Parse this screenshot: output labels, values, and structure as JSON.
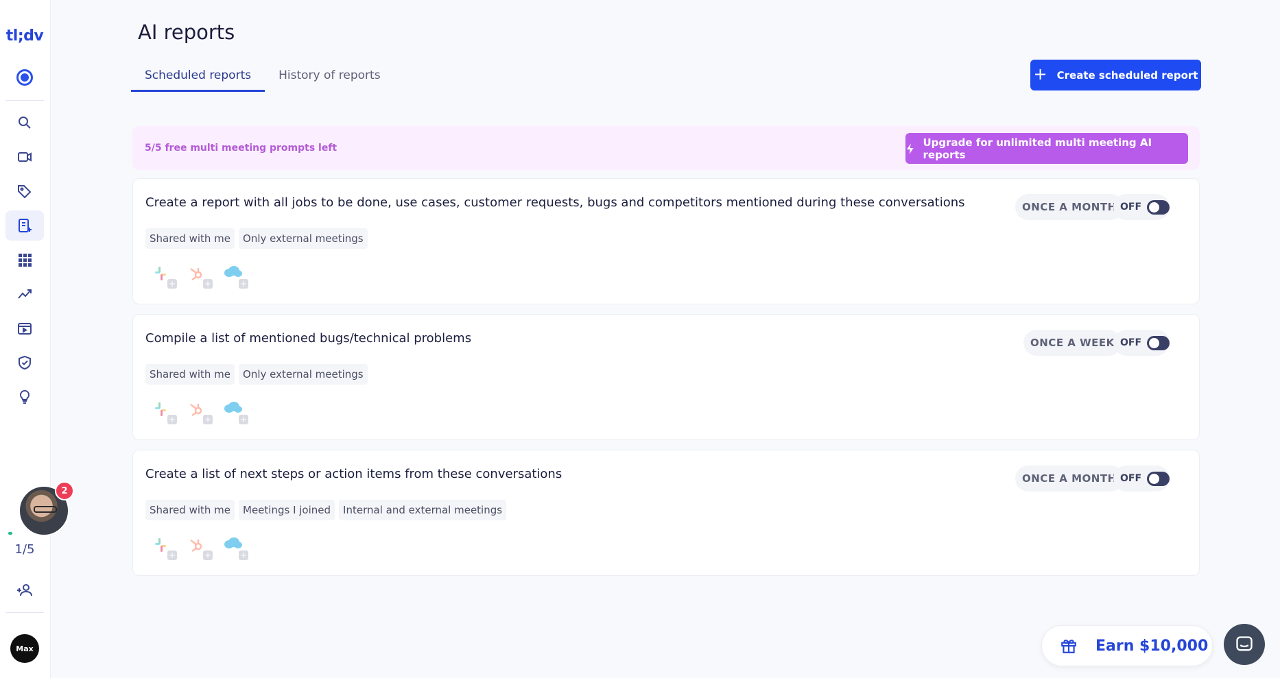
{
  "app": {
    "logo": "tl;dv"
  },
  "sidebar": {
    "items": [
      {
        "icon": "record-icon"
      },
      {
        "icon": "search-icon"
      },
      {
        "icon": "video-icon"
      },
      {
        "icon": "tag-icon"
      },
      {
        "icon": "ai-report-icon",
        "active": true
      },
      {
        "icon": "apps-grid-icon"
      },
      {
        "icon": "trend-icon"
      },
      {
        "icon": "clips-icon"
      },
      {
        "icon": "shield-icon"
      },
      {
        "icon": "lightbulb-icon"
      },
      {
        "icon": "add-user-icon"
      }
    ],
    "notification_count": "2",
    "progress": "1/5",
    "brand_badge": "Max"
  },
  "header": {
    "title": "AI reports",
    "tabs": [
      {
        "label": "Scheduled reports",
        "active": true
      },
      {
        "label": "History of reports",
        "active": false
      }
    ],
    "create_button": "Create scheduled report"
  },
  "promo": {
    "text": "5/5 free multi meeting prompts left",
    "upgrade_button": "Upgrade for unlimited multi meeting AI reports"
  },
  "reports": [
    {
      "title": "Create a report with all jobs to be done, use cases, customer requests, bugs and competitors mentioned during these conversations",
      "frequency": "ONCE A MONTH",
      "toggle": "OFF",
      "chips": [
        "Shared with me",
        "Only external meetings"
      ]
    },
    {
      "title": "Compile a list of mentioned bugs/technical problems",
      "frequency": "ONCE A WEEK",
      "toggle": "OFF",
      "chips": [
        "Shared with me",
        "Only external meetings"
      ]
    },
    {
      "title": "Create a list of next steps or action items from these conversations",
      "frequency": "ONCE A MONTH",
      "toggle": "OFF",
      "chips": [
        "Shared with me",
        "Meetings I joined",
        "Internal and external meetings"
      ]
    }
  ],
  "integrations": [
    "slack-icon",
    "hubspot-icon",
    "salesforce-icon"
  ],
  "footer": {
    "earn_label": "Earn $10,000"
  },
  "colors": {
    "primary": "#1f4bf2",
    "upgrade": "#b85bea",
    "promo_bg": "#fbefff"
  }
}
